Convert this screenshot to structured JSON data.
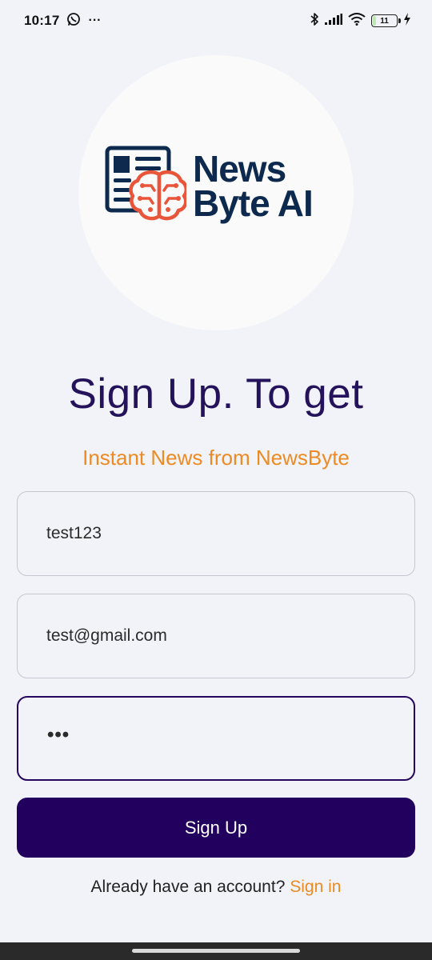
{
  "status_bar": {
    "time": "10:17",
    "more": "···",
    "battery": "11",
    "icons": [
      "whatsapp-icon",
      "more-icon",
      "bluetooth-icon",
      "signal-icon",
      "wifi-icon",
      "battery-icon",
      "charging-icon"
    ]
  },
  "logo": {
    "line1": "News",
    "line2": "Byte AI"
  },
  "heading": "Sign Up. To get",
  "subheading": "Instant News from NewsByte",
  "form": {
    "username": "test123",
    "email": "test@gmail.com",
    "password_masked": "•••"
  },
  "signup_button": "Sign Up",
  "footer": {
    "prompt": "Already have an account? ",
    "link": "Sign in"
  },
  "colors": {
    "background": "#f1f3f9",
    "heading": "#24135a",
    "accent": "#ee8a22",
    "button": "#22005e",
    "logo_text": "#0d2a4e",
    "logo_brain": "#e8553a"
  }
}
